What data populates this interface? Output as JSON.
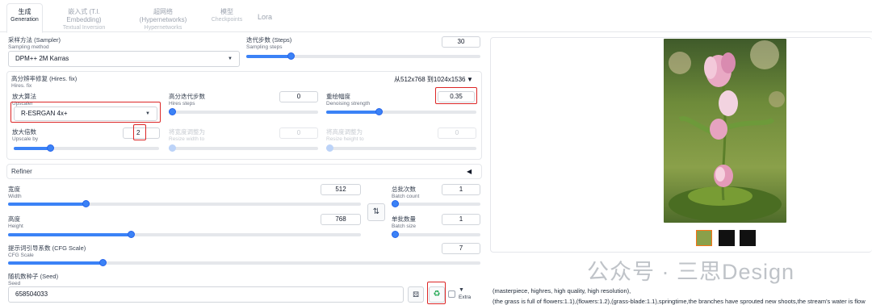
{
  "tabs": [
    {
      "zh": "生成",
      "en": "Generation"
    },
    {
      "zh": "嵌入式 (T.I. Embedding)",
      "en": "Textual Inversion"
    },
    {
      "zh": "超网络 (Hypernetworks)",
      "en": "Hypernetworks"
    },
    {
      "zh": "模型",
      "en": "Checkpoints"
    },
    {
      "zh": "Lora",
      "en": ""
    }
  ],
  "sampler": {
    "label_zh": "采样方法 (Sampler)",
    "label_en": "Sampling method",
    "value": "DPM++ 2M Karras"
  },
  "steps": {
    "label_zh": "迭代步数 (Steps)",
    "label_en": "Sampling steps",
    "value": "30",
    "fraction": 0.19
  },
  "hires": {
    "label_zh": "高分辨率修复 (Hires. fix)",
    "label_en": "Hires. fix",
    "resolution": "从512x768 到1024x1536",
    "toggle": "▼",
    "upscaler": {
      "label_zh": "放大算法",
      "label_en": "Upscaler",
      "value": "R-ESRGAN 4x+"
    },
    "hires_steps": {
      "label_zh": "高分迭代步数",
      "label_en": "Hires steps",
      "value": "0",
      "fraction": 0.0
    },
    "denoising": {
      "label_zh": "重绘幅度",
      "label_en": "Denoising strength",
      "value": "0.35",
      "fraction": 0.35
    },
    "upscale_by": {
      "label_zh": "放大倍数",
      "label_en": "Upscale by",
      "value": "2",
      "fraction": 0.25
    },
    "resize_w": {
      "label_zh": "将宽度调整为",
      "label_en": "Resize width to",
      "value": "0",
      "fraction": 0.0
    },
    "resize_h": {
      "label_zh": "将高度调整为",
      "label_en": "Resize height to",
      "value": "0",
      "fraction": 0.0
    }
  },
  "refiner": {
    "label": "Refiner",
    "toggle": "◀"
  },
  "width": {
    "label_zh": "宽度",
    "label_en": "Width",
    "value": "512",
    "fraction": 0.22
  },
  "height": {
    "label_zh": "高度",
    "label_en": "Height",
    "value": "768",
    "fraction": 0.35
  },
  "swap_icon": "⇅",
  "batch_count": {
    "label_zh": "总批次数",
    "label_en": "Batch count",
    "value": "1",
    "fraction": 0.0
  },
  "batch_size": {
    "label_zh": "单批数量",
    "label_en": "Batch size",
    "value": "1",
    "fraction": 0.0
  },
  "cfg": {
    "label_zh": "提示词引导系数 (CFG Scale)",
    "label_en": "CFG Scale",
    "value": "7",
    "fraction": 0.2
  },
  "seed": {
    "label_zh": "随机数种子 (Seed)",
    "label_en": "Seed",
    "value": "658504033",
    "extra_toggle": "▼",
    "extra_label": "Extra"
  },
  "prompt": {
    "line1": "(masterpiece, highres, high quality, high resolution),",
    "line2": "(the grass is full of flowers:1.1),(flowers:1.2),(grass-blade:1.1),springtime,the branches have sprouted new shoots,the stream's water is flow"
  },
  "watermark": "公众号 · 三思Design",
  "colors": {
    "accent": "#3b82f6",
    "highlight": "#dc2626"
  }
}
